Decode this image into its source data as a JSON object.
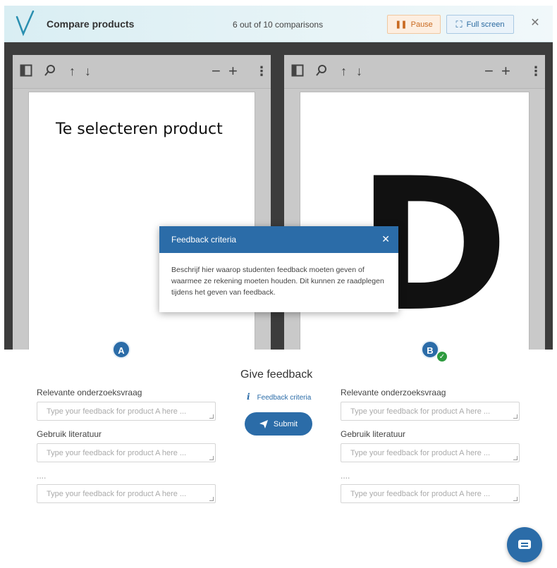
{
  "header": {
    "title": "Compare products",
    "progress": "6 out of 10 comparisons",
    "pause_label": "Pause",
    "fullscreen_label": "Full screen"
  },
  "viewer_a": {
    "page_text": "Te selecteren product"
  },
  "viewer_b": {
    "page_text": "D"
  },
  "modal": {
    "title": "Feedback criteria",
    "body": "Beschrijf hier waarop studenten feedback moeten geven of waarmee ze rekening moeten houden. Dit kunnen ze raadplegen tijdens het geven van feedback."
  },
  "feedback": {
    "title": "Give feedback",
    "criteria_link": "Feedback criteria",
    "submit_label": "Submit",
    "badge_a": "A",
    "badge_b": "B",
    "labels": [
      "Relevante onderzoeksvraag",
      "Gebruik literatuur",
      "...."
    ],
    "placeholder_a": "Type your feedback for product A here ...",
    "placeholder_b": "Type your feedback for product A here ..."
  },
  "colors": {
    "primary": "#2b6ca8",
    "pause": "#c96a20",
    "check": "#2e9b3f"
  }
}
